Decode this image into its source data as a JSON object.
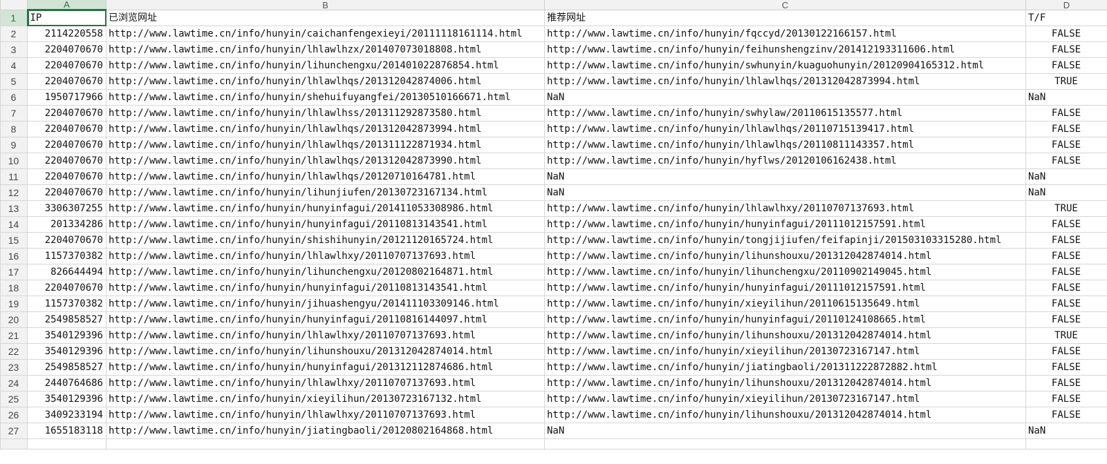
{
  "columns": [
    "A",
    "B",
    "C",
    "D"
  ],
  "header_row": {
    "row_number": "1",
    "cells": [
      "IP",
      "已浏览网址",
      "推荐网址",
      "T/F"
    ]
  },
  "rows": [
    {
      "n": "2",
      "ip": "2114220558",
      "viewed": "http://www.lawtime.cn/info/hunyin/caichanfengexieyi/20111118161114.html",
      "recommended": "http://www.lawtime.cn/info/hunyin/fqccyd/20130122166157.html",
      "tf": "FALSE"
    },
    {
      "n": "3",
      "ip": "2204070670",
      "viewed": "http://www.lawtime.cn/info/hunyin/lhlawlhzx/201407073018808.html",
      "recommended": "http://www.lawtime.cn/info/hunyin/feihunshengzinv/201412193311606.html",
      "tf": "FALSE"
    },
    {
      "n": "4",
      "ip": "2204070670",
      "viewed": "http://www.lawtime.cn/info/hunyin/lihunchengxu/201401022876854.html",
      "recommended": "http://www.lawtime.cn/info/hunyin/swhunyin/kuaguohunyin/20120904165312.html",
      "tf": "FALSE"
    },
    {
      "n": "5",
      "ip": "2204070670",
      "viewed": "http://www.lawtime.cn/info/hunyin/lhlawlhqs/201312042874006.html",
      "recommended": "http://www.lawtime.cn/info/hunyin/lhlawlhqs/201312042873994.html",
      "tf": "TRUE"
    },
    {
      "n": "6",
      "ip": "1950717966",
      "viewed": "http://www.lawtime.cn/info/hunyin/shehuifuyangfei/20130510166671.html",
      "recommended": "NaN",
      "tf": "NaN"
    },
    {
      "n": "7",
      "ip": "2204070670",
      "viewed": "http://www.lawtime.cn/info/hunyin/lhlawlhss/201311292873580.html",
      "recommended": "http://www.lawtime.cn/info/hunyin/swhylaw/20110615135577.html",
      "tf": "FALSE"
    },
    {
      "n": "8",
      "ip": "2204070670",
      "viewed": "http://www.lawtime.cn/info/hunyin/lhlawlhqs/201312042873994.html",
      "recommended": "http://www.lawtime.cn/info/hunyin/lhlawlhqs/20110715139417.html",
      "tf": "FALSE"
    },
    {
      "n": "9",
      "ip": "2204070670",
      "viewed": "http://www.lawtime.cn/info/hunyin/lhlawlhqs/201311122871934.html",
      "recommended": "http://www.lawtime.cn/info/hunyin/lhlawlhqs/20110811143357.html",
      "tf": "FALSE"
    },
    {
      "n": "10",
      "ip": "2204070670",
      "viewed": "http://www.lawtime.cn/info/hunyin/lhlawlhqs/201312042873990.html",
      "recommended": "http://www.lawtime.cn/info/hunyin/hyflws/20120106162438.html",
      "tf": "FALSE"
    },
    {
      "n": "11",
      "ip": "2204070670",
      "viewed": "http://www.lawtime.cn/info/hunyin/lhlawlhqs/20120710164781.html",
      "recommended": "NaN",
      "tf": "NaN"
    },
    {
      "n": "12",
      "ip": "2204070670",
      "viewed": "http://www.lawtime.cn/info/hunyin/lihunjiufen/20130723167134.html",
      "recommended": "NaN",
      "tf": "NaN"
    },
    {
      "n": "13",
      "ip": "3306307255",
      "viewed": "http://www.lawtime.cn/info/hunyin/hunyinfagui/201411053308986.html",
      "recommended": "http://www.lawtime.cn/info/hunyin/lhlawlhxy/20110707137693.html",
      "tf": "TRUE"
    },
    {
      "n": "14",
      "ip": "201334286",
      "viewed": "http://www.lawtime.cn/info/hunyin/hunyinfagui/20110813143541.html",
      "recommended": "http://www.lawtime.cn/info/hunyin/hunyinfagui/20111012157591.html",
      "tf": "FALSE"
    },
    {
      "n": "15",
      "ip": "2204070670",
      "viewed": "http://www.lawtime.cn/info/hunyin/shishihunyin/20121120165724.html",
      "recommended": "http://www.lawtime.cn/info/hunyin/tongjijiufen/feifapinji/201503103315280.html",
      "tf": "FALSE"
    },
    {
      "n": "16",
      "ip": "1157370382",
      "viewed": "http://www.lawtime.cn/info/hunyin/lhlawlhxy/20110707137693.html",
      "recommended": "http://www.lawtime.cn/info/hunyin/lihunshouxu/201312042874014.html",
      "tf": "FALSE"
    },
    {
      "n": "17",
      "ip": "826644494",
      "viewed": "http://www.lawtime.cn/info/hunyin/lihunchengxu/20120802164871.html",
      "recommended": "http://www.lawtime.cn/info/hunyin/lihunchengxu/20110902149045.html",
      "tf": "FALSE"
    },
    {
      "n": "18",
      "ip": "2204070670",
      "viewed": "http://www.lawtime.cn/info/hunyin/hunyinfagui/20110813143541.html",
      "recommended": "http://www.lawtime.cn/info/hunyin/hunyinfagui/20111012157591.html",
      "tf": "FALSE"
    },
    {
      "n": "19",
      "ip": "1157370382",
      "viewed": "http://www.lawtime.cn/info/hunyin/jihuashengyu/201411103309146.html",
      "recommended": "http://www.lawtime.cn/info/hunyin/xieyilihun/20110615135649.html",
      "tf": "FALSE"
    },
    {
      "n": "20",
      "ip": "2549858527",
      "viewed": "http://www.lawtime.cn/info/hunyin/hunyinfagui/20110816144097.html",
      "recommended": "http://www.lawtime.cn/info/hunyin/hunyinfagui/20110124108665.html",
      "tf": "FALSE"
    },
    {
      "n": "21",
      "ip": "3540129396",
      "viewed": "http://www.lawtime.cn/info/hunyin/lhlawlhxy/20110707137693.html",
      "recommended": "http://www.lawtime.cn/info/hunyin/lihunshouxu/201312042874014.html",
      "tf": "TRUE"
    },
    {
      "n": "22",
      "ip": "3540129396",
      "viewed": "http://www.lawtime.cn/info/hunyin/lihunshouxu/201312042874014.html",
      "recommended": "http://www.lawtime.cn/info/hunyin/xieyilihun/20130723167147.html",
      "tf": "FALSE"
    },
    {
      "n": "23",
      "ip": "2549858527",
      "viewed": "http://www.lawtime.cn/info/hunyin/hunyinfagui/201312112874686.html",
      "recommended": "http://www.lawtime.cn/info/hunyin/jiatingbaoli/201311222872882.html",
      "tf": "FALSE"
    },
    {
      "n": "24",
      "ip": "2440764686",
      "viewed": "http://www.lawtime.cn/info/hunyin/lhlawlhxy/20110707137693.html",
      "recommended": "http://www.lawtime.cn/info/hunyin/lihunshouxu/201312042874014.html",
      "tf": "FALSE"
    },
    {
      "n": "25",
      "ip": "3540129396",
      "viewed": "http://www.lawtime.cn/info/hunyin/xieyilihun/20130723167132.html",
      "recommended": "http://www.lawtime.cn/info/hunyin/xieyilihun/20130723167147.html",
      "tf": "FALSE"
    },
    {
      "n": "26",
      "ip": "3409233194",
      "viewed": "http://www.lawtime.cn/info/hunyin/lhlawlhxy/20110707137693.html",
      "recommended": "http://www.lawtime.cn/info/hunyin/lihunshouxu/201312042874014.html",
      "tf": "FALSE"
    },
    {
      "n": "27",
      "ip": "1655183118",
      "viewed": "http://www.lawtime.cn/info/hunyin/jiatingbaoli/20120802164868.html",
      "recommended": "NaN",
      "tf": "NaN"
    }
  ],
  "colors": {
    "accent": "#217346",
    "header_bg": "#f2f2f2",
    "selected_header_bg": "#d2e4d6",
    "gridline": "#d6d6d6"
  }
}
